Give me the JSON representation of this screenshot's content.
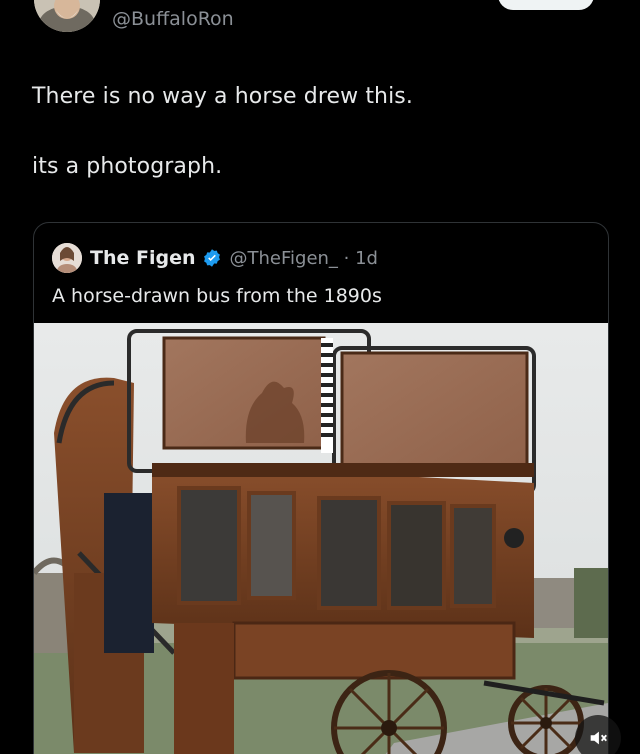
{
  "author": {
    "handle": "@BuffaloRon",
    "avatar_icon": "user-avatar-icon"
  },
  "tweet": {
    "line1": "There is no way a horse drew this.",
    "line2": "its a photograph."
  },
  "quote": {
    "name": "The Figen",
    "handle_time": "@TheFigen_ · 1d",
    "text": "A horse-drawn bus from the 1890s",
    "verified_icon": "verified-badge-icon",
    "media_icon": "photo-horse-drawn-bus"
  },
  "controls": {
    "mute_icon": "muted-speaker-icon"
  },
  "colors": {
    "background": "#000000",
    "text": "#e7e9ea",
    "secondary_text": "#8b9096",
    "verified": "#1d9bf0",
    "border": "#2f3336"
  }
}
